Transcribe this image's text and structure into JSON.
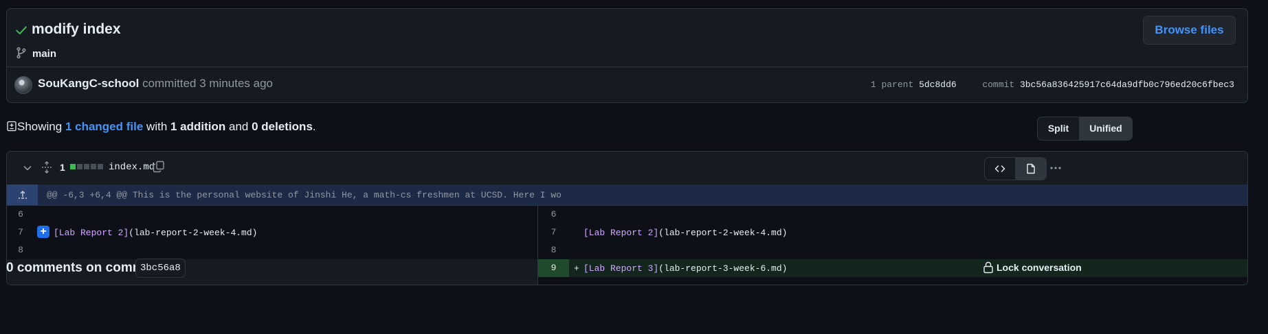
{
  "commit": {
    "title": "modify index",
    "branch": "main",
    "browse_label": "Browse files",
    "author": "SouKangC-school",
    "action": " committed 3 minutes ago",
    "parent_count": "1 parent",
    "parent_sha": "5dc8dd6",
    "commit_label": "commit",
    "commit_sha": "3bc56a836425917c64da9dfb0c796ed20c6fbec3"
  },
  "summary": {
    "showing": "Showing ",
    "changed": "1 changed file",
    "with": " with ",
    "additions": "1 addition",
    "and": " and ",
    "deletions": "0 deletions",
    "end": "."
  },
  "view_toggle": {
    "split": "Split",
    "unified": "Unified",
    "selected": "Unified"
  },
  "file": {
    "changes": "1",
    "name": "index.md",
    "diffstat": [
      "add",
      "neutral",
      "neutral",
      "neutral",
      "neutral"
    ],
    "hunk_header": "@@ -6,3 +6,4 @@ This is the personal website of Jinshi He, a math-cs freshmen at UCSD. Here I wo",
    "left": [
      {
        "ln": "6",
        "text": ""
      },
      {
        "ln": "7",
        "bracket": "[Lab Report 2]",
        "rest": "(lab-report-2-week-4.md)"
      },
      {
        "ln": "8",
        "text": ""
      }
    ],
    "right": [
      {
        "ln": "6",
        "text": ""
      },
      {
        "ln": "7",
        "bracket": "[Lab Report 2]",
        "rest": "(lab-report-2-week-4.md)"
      },
      {
        "ln": "8",
        "text": ""
      },
      {
        "ln": "9",
        "sign": "+",
        "bracket": "[Lab Report 3]",
        "rest": "(lab-report-3-week-6.md)"
      }
    ]
  },
  "comments": {
    "title": "0 comments on commit",
    "sha": "3bc56a8",
    "lock_label": "Lock conversation"
  },
  "colors": {
    "accent": "#4493f8",
    "addition": "#3fb950",
    "background": "#0d1117"
  }
}
